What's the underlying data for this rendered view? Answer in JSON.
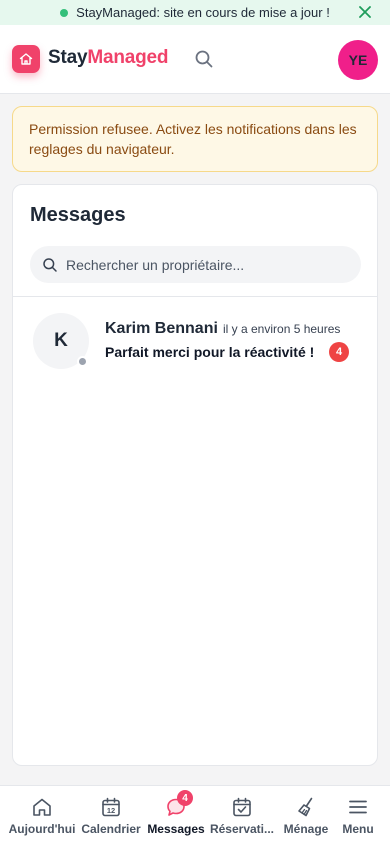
{
  "banner": {
    "text": "StayManaged: site en cours de mise a jour !",
    "status_color": "#34c07a"
  },
  "header": {
    "logo_part1": "Stay",
    "logo_part2": "Managed",
    "brand_color": "#f0426a",
    "avatar_initials": "YE",
    "avatar_color": "#f01f8a"
  },
  "warning": {
    "text": "Permission refusee. Activez les notifications dans les reglages du navigateur."
  },
  "messages": {
    "title": "Messages",
    "search_placeholder": "Rechercher un propriétaire...",
    "conversations": [
      {
        "initial": "K",
        "name": "Karim Bennani",
        "time": "il y a environ 5 heures",
        "preview": "Parfait merci pour la réactivité !",
        "unread": "4",
        "presence": "offline"
      }
    ]
  },
  "nav": {
    "items": [
      {
        "label": "Aujourd'hui",
        "icon": "home-icon"
      },
      {
        "label": "Calendrier",
        "icon": "calendar-icon",
        "icon_text": "12"
      },
      {
        "label": "Messages",
        "icon": "chat-bubble-icon",
        "badge": "4",
        "active": true
      },
      {
        "label": "Réservati...",
        "icon": "calendar-check-icon"
      },
      {
        "label": "Ménage",
        "icon": "broom-icon"
      },
      {
        "label": "Menu",
        "icon": "menu-icon"
      }
    ]
  }
}
